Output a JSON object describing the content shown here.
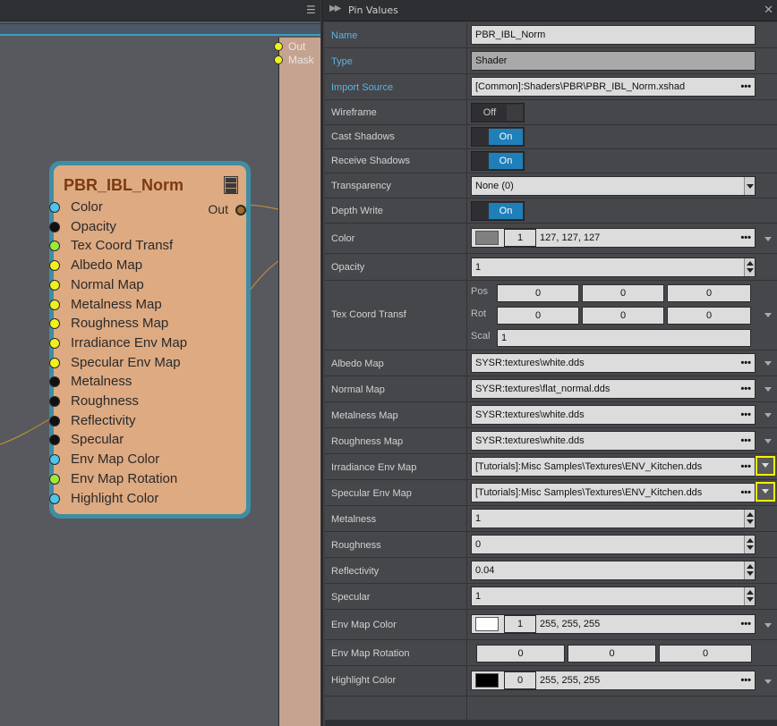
{
  "graph": {
    "side_node_outputs": [
      "Out",
      "Mask"
    ],
    "node": {
      "title": "PBR_IBL_Norm",
      "output_label": "Out",
      "pins": [
        {
          "label": "Color",
          "color": "#4fc3e8"
        },
        {
          "label": "Opacity",
          "color": "#111111"
        },
        {
          "label": "Tex Coord Transf",
          "color": "#9ee83a"
        },
        {
          "label": "Albedo Map",
          "color": "#f0f020"
        },
        {
          "label": "Normal Map",
          "color": "#f0f020"
        },
        {
          "label": "Metalness Map",
          "color": "#f0f020"
        },
        {
          "label": "Roughness Map",
          "color": "#f0f020"
        },
        {
          "label": "Irradiance Env Map",
          "color": "#f0f020"
        },
        {
          "label": "Specular Env Map",
          "color": "#f0f020"
        },
        {
          "label": "Metalness",
          "color": "#111111"
        },
        {
          "label": "Roughness",
          "color": "#111111"
        },
        {
          "label": "Reflectivity",
          "color": "#111111"
        },
        {
          "label": "Specular",
          "color": "#111111"
        },
        {
          "label": "Env Map Color",
          "color": "#4fc3e8"
        },
        {
          "label": "Env Map Rotation",
          "color": "#9ee83a"
        },
        {
          "label": "Highlight Color",
          "color": "#4fc3e8"
        }
      ]
    }
  },
  "panel": {
    "title": "Pin Values",
    "rows": {
      "name": {
        "label": "Name",
        "value": "PBR_IBL_Norm"
      },
      "type": {
        "label": "Type",
        "value": "Shader"
      },
      "import_source": {
        "label": "Import Source",
        "value": "[Common]:Shaders\\PBR\\PBR_IBL_Norm.xshad"
      },
      "wireframe": {
        "label": "Wireframe",
        "value": "Off"
      },
      "cast_shadows": {
        "label": "Cast Shadows",
        "value": "On"
      },
      "receive_shadows": {
        "label": "Receive Shadows",
        "value": "On"
      },
      "transparency": {
        "label": "Transparency",
        "value": "None (0)"
      },
      "depth_write": {
        "label": "Depth Write",
        "value": "On"
      },
      "color": {
        "label": "Color",
        "swatch": "#808080",
        "alpha": "1",
        "rgb": "127, 127, 127"
      },
      "opacity": {
        "label": "Opacity",
        "value": "1"
      },
      "tex_coord": {
        "label": "Tex Coord Transf",
        "pos_label": "Pos",
        "pos": [
          "0",
          "0",
          "0"
        ],
        "rot_label": "Rot",
        "rot": [
          "0",
          "0",
          "0"
        ],
        "scal_label": "Scal",
        "scal": "1"
      },
      "albedo_map": {
        "label": "Albedo Map",
        "value": "SYSR:textures\\white.dds"
      },
      "normal_map": {
        "label": "Normal Map",
        "value": "SYSR:textures\\flat_normal.dds"
      },
      "metalness_map": {
        "label": "Metalness Map",
        "value": "SYSR:textures\\white.dds"
      },
      "roughness_map": {
        "label": "Roughness Map",
        "value": "SYSR:textures\\white.dds"
      },
      "irradiance_env_map": {
        "label": "Irradiance Env Map",
        "value": "[Tutorials]:Misc Samples\\Textures\\ENV_Kitchen.dds"
      },
      "specular_env_map": {
        "label": "Specular Env Map",
        "value": "[Tutorials]:Misc Samples\\Textures\\ENV_Kitchen.dds"
      },
      "metalness": {
        "label": "Metalness",
        "value": "1"
      },
      "roughness": {
        "label": "Roughness",
        "value": "0"
      },
      "reflectivity": {
        "label": "Reflectivity",
        "value": "0.04"
      },
      "specular": {
        "label": "Specular",
        "value": "1"
      },
      "env_map_color": {
        "label": "Env Map Color",
        "swatch": "#ffffff",
        "alpha": "1",
        "rgb": "255, 255, 255"
      },
      "env_map_rotation": {
        "label": "Env Map Rotation",
        "values": [
          "0",
          "0",
          "0"
        ]
      },
      "highlight_color": {
        "label": "Highlight Color",
        "swatch": "#000000",
        "alpha": "0",
        "rgb": "255, 255, 255"
      }
    },
    "dots": "•••"
  }
}
